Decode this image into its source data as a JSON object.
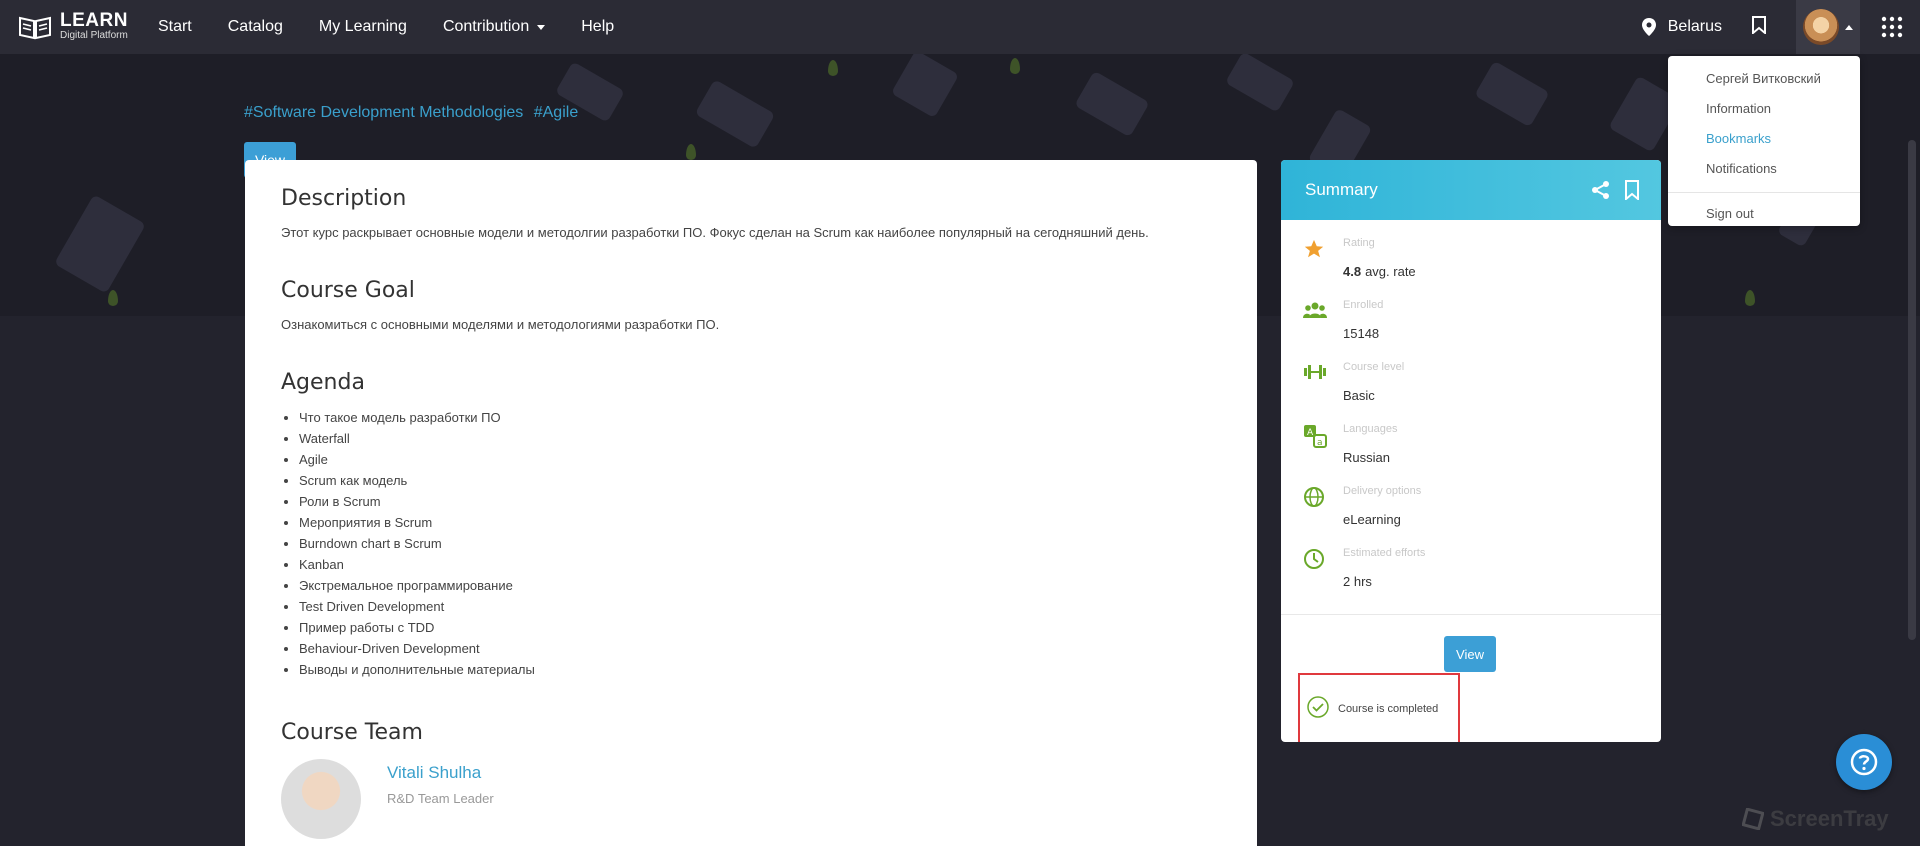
{
  "brand": {
    "name": "LEARN",
    "tagline": "Digital Platform"
  },
  "nav": [
    {
      "label": "Start"
    },
    {
      "label": "Catalog"
    },
    {
      "label": "My Learning"
    },
    {
      "label": "Contribution"
    },
    {
      "label": "Help"
    }
  ],
  "location": "Belarus",
  "user_menu": {
    "name": "Сергей Витковский",
    "items": [
      "Information",
      "Bookmarks",
      "Notifications"
    ],
    "active_item": "Bookmarks",
    "sign_out": "Sign out"
  },
  "hero": {
    "tags": [
      "#Software Development Methodologies",
      "#Agile"
    ],
    "view_button": "View"
  },
  "description": {
    "title": "Description",
    "text": "Этот курс раскрывает основные модели и методолгии разработки ПО. Фокус сделан на Scrum как наиболее популярный на сегодняшний день."
  },
  "goal": {
    "title": "Course Goal",
    "text": "Ознакомиться с основными моделями и методологиями разработки ПО."
  },
  "agenda": {
    "title": "Agenda",
    "items": [
      "Что такое модель разработки ПО",
      "Waterfall",
      "Agile",
      "Scrum как модель",
      "Роли в Scrum",
      "Мероприятия в Scrum",
      "Burndown chart в Scrum",
      "Kanban",
      "Экстремальное программирование",
      "Test Driven Development",
      "Пример работы с TDD",
      "Behaviour-Driven Development",
      "Выводы и дополнительные материалы"
    ]
  },
  "team": {
    "title": "Course Team",
    "member_name": "Vitali Shulha",
    "member_role": "R&D Team Leader"
  },
  "summary": {
    "title": "Summary",
    "rating_label": "Rating",
    "rating_value": "4.8",
    "rating_suffix": "avg. rate",
    "enrolled_label": "Enrolled",
    "enrolled_value": "15148",
    "level_label": "Course level",
    "level_value": "Basic",
    "languages_label": "Languages",
    "languages_value": "Russian",
    "delivery_label": "Delivery options",
    "delivery_value": "eLearning",
    "efforts_label": "Estimated efforts",
    "efforts_value": "2 hrs",
    "view_button": "View",
    "completed_text": "Course is completed"
  },
  "watermark": "ScreenTray",
  "colors": {
    "accent": "#3aa0cc",
    "button": "#3c9fd6",
    "summary_header": "#2fb4d8",
    "icon_green": "#6aa82a",
    "highlight_border": "#e0393e"
  }
}
